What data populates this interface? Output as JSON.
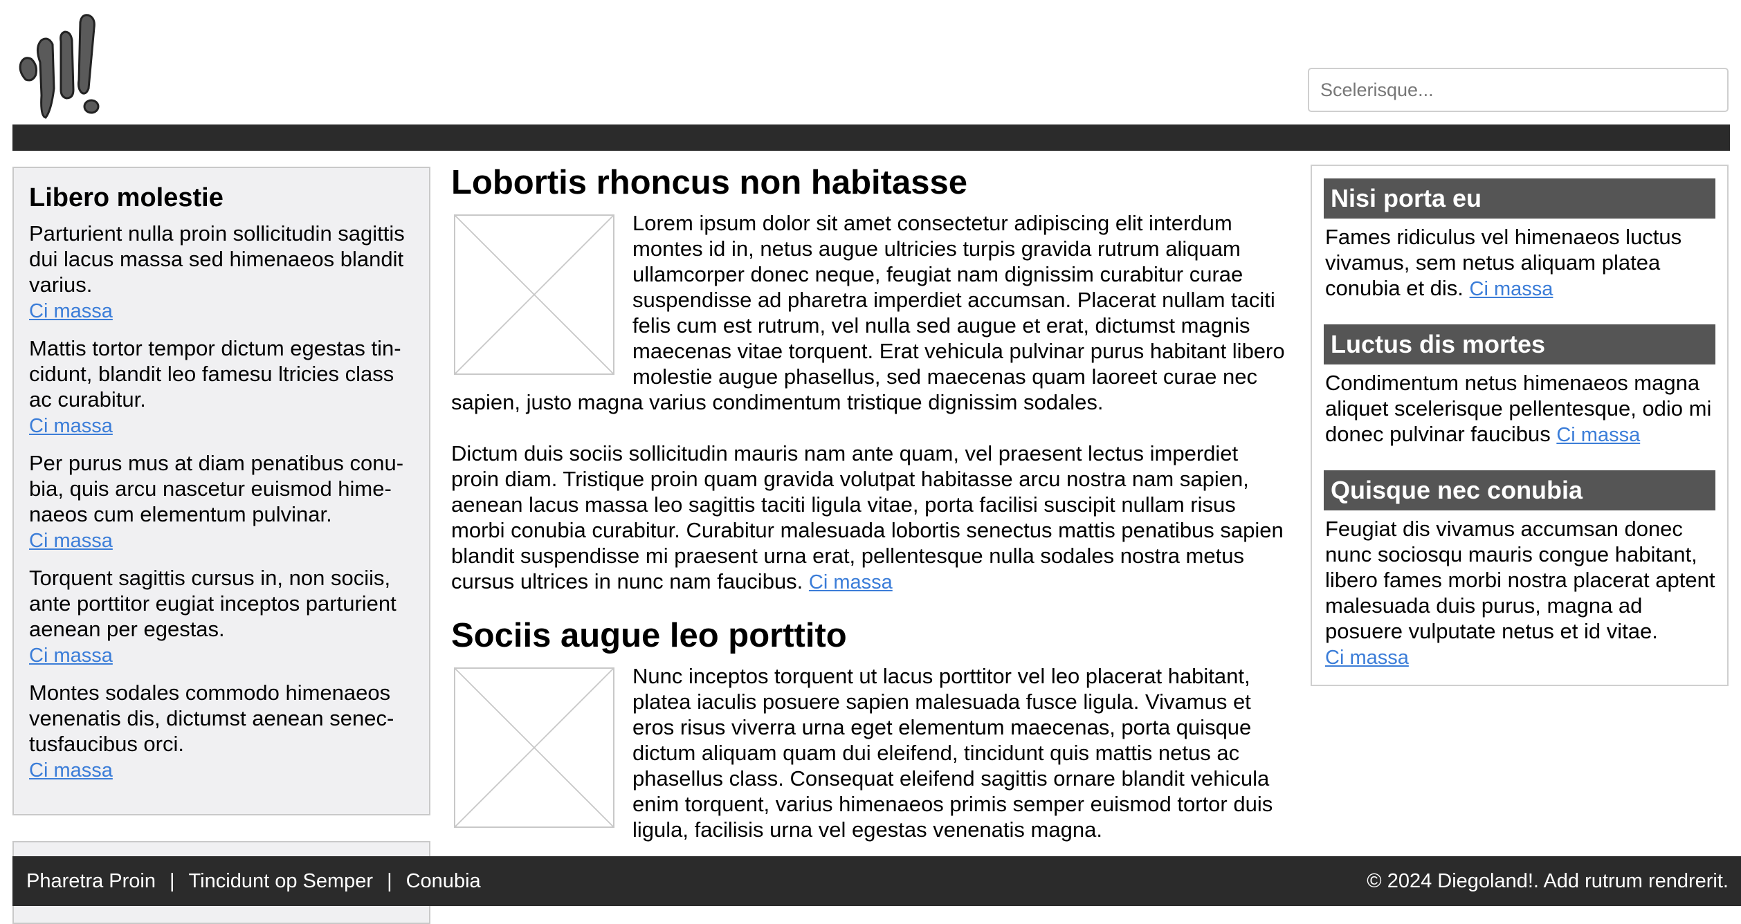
{
  "header": {
    "logo_icon": "diego-logo",
    "search_placeholder": "Scelerisque..."
  },
  "left_sidebar": {
    "title": "Libero molestie",
    "items": [
      {
        "text": "Parturient nulla proin sollicitudin sagittis dui lacus massa sed himenaeos blandit varius.",
        "link": "Ci massa"
      },
      {
        "text": "Mattis tortor tempor dictum egestas tin­cidunt, blandit leo famesu ltricies class ac curabitur.",
        "link": "Ci massa"
      },
      {
        "text": "Per purus mus at diam penatibus conu­bia, quis arcu nascetur euismod hime­naeos cum elementum pulvinar.",
        "link": "Ci massa"
      },
      {
        "text": "Torquent sagittis cursus in, non sociis, ante porttitor eugiat inceptos parturient aenean per egestas.",
        "link": "Ci massa"
      },
      {
        "text": "Montes sodales commodo himenaeos venenatis dis, dictumst aenean senec­tusfaucibus orci.",
        "link": "Ci massa"
      }
    ]
  },
  "main": {
    "article1": {
      "title": "Lobortis rhoncus non habitasse",
      "para1": "Lorem ipsum dolor sit amet consectetur adipiscing elit interdum montes id in, netus augue ultricies turpis gravida rutrum aliquam ullamcorper donec neque, feugiat nam dignissim curabitur curae suspendisse ad pharetra imperdiet accumsan. Placerat nullam tac­iti felis cum est rutrum, vel nulla sed augue et erat, dictumst mag­nis maecenas vitae torquent. Erat vehicula pulvinar purus habitant libero molestie augue phasellus, sed maecenas quam laoreet cu­rae nec sapien, justo magna varius condimentum tristique dignissim sodales.",
      "para2": "Dictum duis sociis sollicitudin mauris nam ante quam, vel praesent lectus imperdiet proin diam. Tristique proin quam gravida volutpat habitasse arcu nostra nam sapien, aenean lacus massa leo sagittis taciti ligula vitae, porta facilisi suscipit nullam risus morbi conubia curabitur. Curabitur malesuada lobortis senectus mattis penatibus sapien blandit suspendisse mi praesent urna erat, pellentesque nulla sodales nostra metus cursus ultrices in nunc nam faucibus.",
      "link": "Ci massa"
    },
    "article2": {
      "title": "Sociis augue leo porttito",
      "para1": "Nunc inceptos torquent ut lacus porttitor vel leo placerat habitant, platea iaculis posuere sapien malesuada fusce ligula. Vivamus et eros risus viverra urna eget elementum maecenas, porta quisque dictum aliquam quam dui eleifend, tincidunt quis mattis netus ac phasellus class. Consequat eleifend sagittis ornare blandit vehicula enim torquent, varius himenaeos primis semper euismod tortor duis ligula, facilisis urna vel egestas venenatis magna."
    }
  },
  "right_sidebar": {
    "widgets": [
      {
        "title": "Nisi porta eu",
        "text": "Fames ridiculus vel himenaeos luctus vivamus, sem netus aliquam platea conubia et dis.",
        "link": "Ci massa"
      },
      {
        "title": "Luctus dis mortes",
        "text": "Condimentum netus himenaeos magna aliquet scelerisque pellentesque, odio mi donec pulvinar faucibus",
        "link": "Ci massa"
      },
      {
        "title": "Quisque nec conubia",
        "text": "Feugiat dis vivamus accumsan donec nunc sociosqu mauris congue habitant, libero fames morbi nostra placerat aptent malesuada duis purus, magna ad posuere vulputate netus et id vitae.",
        "link": "Ci massa"
      }
    ]
  },
  "footer": {
    "links": [
      "Pharetra Proin",
      "Tincidunt op Semper",
      "Conubia"
    ],
    "separator": "|",
    "copyright": "© 2024 Diegoland!. Add rutrum rendrerit."
  }
}
